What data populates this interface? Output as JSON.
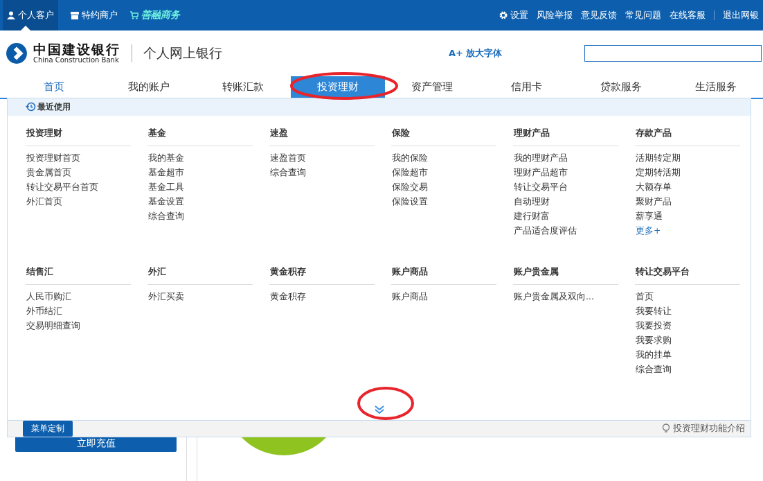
{
  "top_bar": {
    "left_links": [
      {
        "label": "个人客户",
        "kind": "person",
        "selected": true
      },
      {
        "label": "特约商户",
        "kind": "shop",
        "selected": false
      },
      {
        "label": "善融商务",
        "kind": "cart",
        "selected": false
      }
    ],
    "right_links": [
      {
        "label": "设置",
        "kind": "gear"
      },
      {
        "label": "风险举报",
        "kind": "text"
      },
      {
        "label": "意见反馈",
        "kind": "text"
      },
      {
        "label": "常见问题",
        "kind": "text"
      },
      {
        "label": "在线客服",
        "kind": "text"
      },
      {
        "label": "退出网银",
        "kind": "text"
      }
    ]
  },
  "header": {
    "bank_name": "中国建设银行",
    "bank_name_en": "China Construction Bank",
    "subtitle": "个人网上银行",
    "font_icon": "A+",
    "font_button": "放大字体"
  },
  "nav_tabs": [
    {
      "label": "首页",
      "selected": false
    },
    {
      "label": "我的账户",
      "selected": false
    },
    {
      "label": "转账汇款",
      "selected": false
    },
    {
      "label": "投资理财",
      "selected": true
    },
    {
      "label": "资产管理",
      "selected": false
    },
    {
      "label": "信用卡",
      "selected": false
    },
    {
      "label": "贷款服务",
      "selected": false
    },
    {
      "label": "生活服务",
      "selected": false
    }
  ],
  "menu": {
    "recent_label": "最近使用",
    "sections": [
      {
        "title": "投资理财",
        "links": [
          {
            "label": "投资理财首页",
            "kind": "link"
          },
          {
            "label": "贵金属首页",
            "kind": "link"
          },
          {
            "label": "转让交易平台首页",
            "kind": "link"
          },
          {
            "label": "外汇首页",
            "kind": "link"
          }
        ]
      },
      {
        "title": "基金",
        "links": [
          {
            "label": "我的基金",
            "kind": "link"
          },
          {
            "label": "基金超市",
            "kind": "link"
          },
          {
            "label": "基金工具",
            "kind": "link"
          },
          {
            "label": "基金设置",
            "kind": "link"
          },
          {
            "label": "综合查询",
            "kind": "link"
          }
        ]
      },
      {
        "title": "速盈",
        "links": [
          {
            "label": "速盈首页",
            "kind": "link"
          },
          {
            "label": "综合查询",
            "kind": "link"
          }
        ]
      },
      {
        "title": "保险",
        "links": [
          {
            "label": "我的保险",
            "kind": "link"
          },
          {
            "label": "保险超市",
            "kind": "link"
          },
          {
            "label": "保险交易",
            "kind": "link"
          },
          {
            "label": "保险设置",
            "kind": "link"
          }
        ]
      },
      {
        "title": "理财产品",
        "links": [
          {
            "label": "我的理财产品",
            "kind": "link"
          },
          {
            "label": "理财产品超市",
            "kind": "link"
          },
          {
            "label": "转让交易平台",
            "kind": "link"
          },
          {
            "label": "自动理财",
            "kind": "link"
          },
          {
            "label": "建行财富",
            "kind": "link"
          },
          {
            "label": "产品适合度评估",
            "kind": "link"
          }
        ]
      },
      {
        "title": "存款产品",
        "links": [
          {
            "label": "活期转定期",
            "kind": "link"
          },
          {
            "label": "定期转活期",
            "kind": "link"
          },
          {
            "label": "大额存单",
            "kind": "link"
          },
          {
            "label": "聚财产品",
            "kind": "link"
          },
          {
            "label": "薪享通",
            "kind": "link"
          },
          {
            "label": "更多+",
            "kind": "more"
          }
        ]
      },
      {
        "title": "结售汇",
        "links": [
          {
            "label": "人民币购汇",
            "kind": "link"
          },
          {
            "label": "外币结汇",
            "kind": "link"
          },
          {
            "label": "交易明细查询",
            "kind": "link"
          }
        ]
      },
      {
        "title": "外汇",
        "links": [
          {
            "label": "外汇买卖",
            "kind": "link"
          }
        ]
      },
      {
        "title": "黄金积存",
        "links": [
          {
            "label": "黄金积存",
            "kind": "link"
          }
        ]
      },
      {
        "title": "账户商品",
        "links": [
          {
            "label": "账户商品",
            "kind": "link"
          }
        ]
      },
      {
        "title": "账户贵金属",
        "links": [
          {
            "label": "账户贵金属及双向...",
            "kind": "link"
          }
        ]
      },
      {
        "title": "转让交易平台",
        "links": [
          {
            "label": "首页",
            "kind": "link"
          },
          {
            "label": "我要转让",
            "kind": "link"
          },
          {
            "label": "我要投资",
            "kind": "link"
          },
          {
            "label": "我要求购",
            "kind": "link"
          },
          {
            "label": "我的挂单",
            "kind": "link"
          },
          {
            "label": "综合查询",
            "kind": "link"
          }
        ]
      }
    ],
    "customize_button": "菜单定制",
    "help_link": "投资理财功能介绍"
  },
  "background": {
    "recharge_button": "立即充值"
  }
}
